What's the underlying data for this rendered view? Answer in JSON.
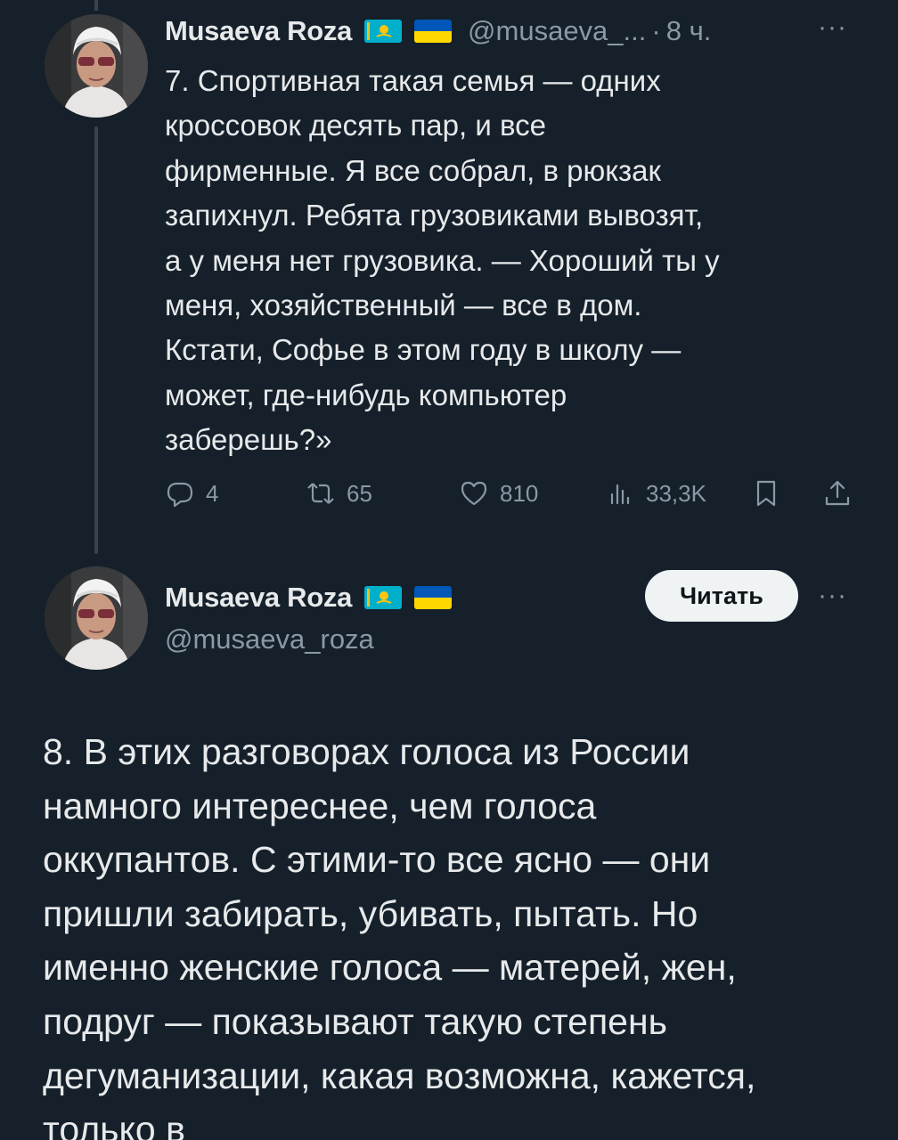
{
  "tweet1": {
    "author_name": "Musaeva Roza",
    "flags": [
      "kazakhstan-flag",
      "ukraine-flag"
    ],
    "handle_short": "@musaeva_...",
    "separator": "·",
    "time": "8 ч.",
    "more": "···",
    "text": "7. Спортивная такая семья — одних\nкроссовок десять пар, и все\nфирменные. Я все собрал, в рюкзак\nзапихнул. Ребята грузовиками вывозят,\nа у меня нет грузовика. — Хороший ты у\nменя, хозяйственный — все в дом.\nКстати, Софье в этом году в школу —\nможет, где-нибудь компьютер\nзаберешь?»",
    "actions": {
      "replies": "4",
      "retweets": "65",
      "likes": "810",
      "views": "33,3K"
    }
  },
  "tweet2": {
    "author_name": "Musaeva Roza",
    "flags": [
      "kazakhstan-flag",
      "ukraine-flag"
    ],
    "handle": "@musaeva_roza",
    "follow_label": "Читать",
    "more": "···",
    "text": "8. В этих разговорах голоса из России\nнамного интереснее, чем голоса\nоккупантов. С этими-то все ясно — они\nпришли забирать, убивать, пытать. Но\nименно женские голоса — матерей, жен,\nподруг — показывают такую степень\nдегуманизации, какая возможна, кажется,\nтолько в"
  },
  "colors": {
    "background": "#15202b",
    "text": "#e7e9ea",
    "secondary": "#8b98a5",
    "button_bg": "#eff3f4"
  }
}
